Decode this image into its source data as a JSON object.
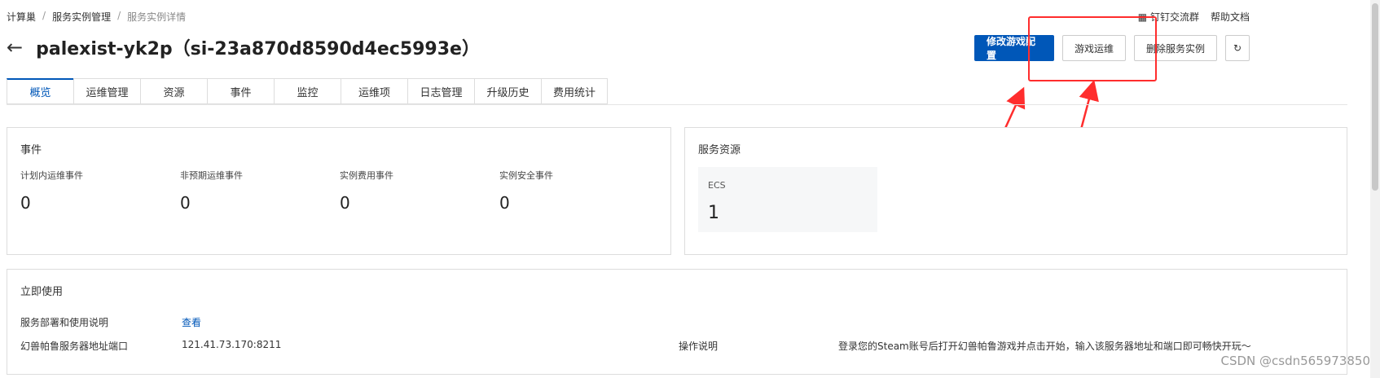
{
  "breadcrumb": [
    "计算巢",
    "服务实例管理",
    "服务实例详情"
  ],
  "toplinks": {
    "dingtalk": "钉钉交流群",
    "help": "帮助文档"
  },
  "title": "palexist-yk2p（si-23a870d8590d4ec5993e）",
  "buttons": {
    "edit_config": "修改游戏配置",
    "game_ops": "游戏运维",
    "delete": "删除服务实例"
  },
  "tabs": [
    "概览",
    "运维管理",
    "资源",
    "事件",
    "监控",
    "运维项",
    "日志管理",
    "升级历史",
    "费用统计"
  ],
  "events": {
    "title": "事件",
    "items": [
      {
        "label": "计划内运维事件",
        "value": "0"
      },
      {
        "label": "非预期运维事件",
        "value": "0"
      },
      {
        "label": "实例费用事件",
        "value": "0"
      },
      {
        "label": "实例安全事件",
        "value": "0"
      }
    ]
  },
  "resources": {
    "title": "服务资源",
    "ecs_label": "ECS",
    "ecs_value": "1"
  },
  "usage": {
    "title": "立即使用",
    "deploy_label": "服务部署和使用说明",
    "deploy_link": "查看",
    "addr_label": "幻兽帕鲁服务器地址端口",
    "addr_value": "121.41.73.170:8211",
    "op_label": "操作说明",
    "op_value": "登录您的Steam账号后打开幻兽帕鲁游戏并点击开始，输入该服务器地址和端口即可畅快开玩～"
  },
  "watermark": "CSDN @csdn565973850",
  "colors": {
    "primary": "#0057b8",
    "highlight": "#ff2d2d"
  },
  "icons": {
    "back": "arrow-left-icon",
    "dingtalk": "qrcode-icon",
    "refresh": "refresh-icon"
  }
}
